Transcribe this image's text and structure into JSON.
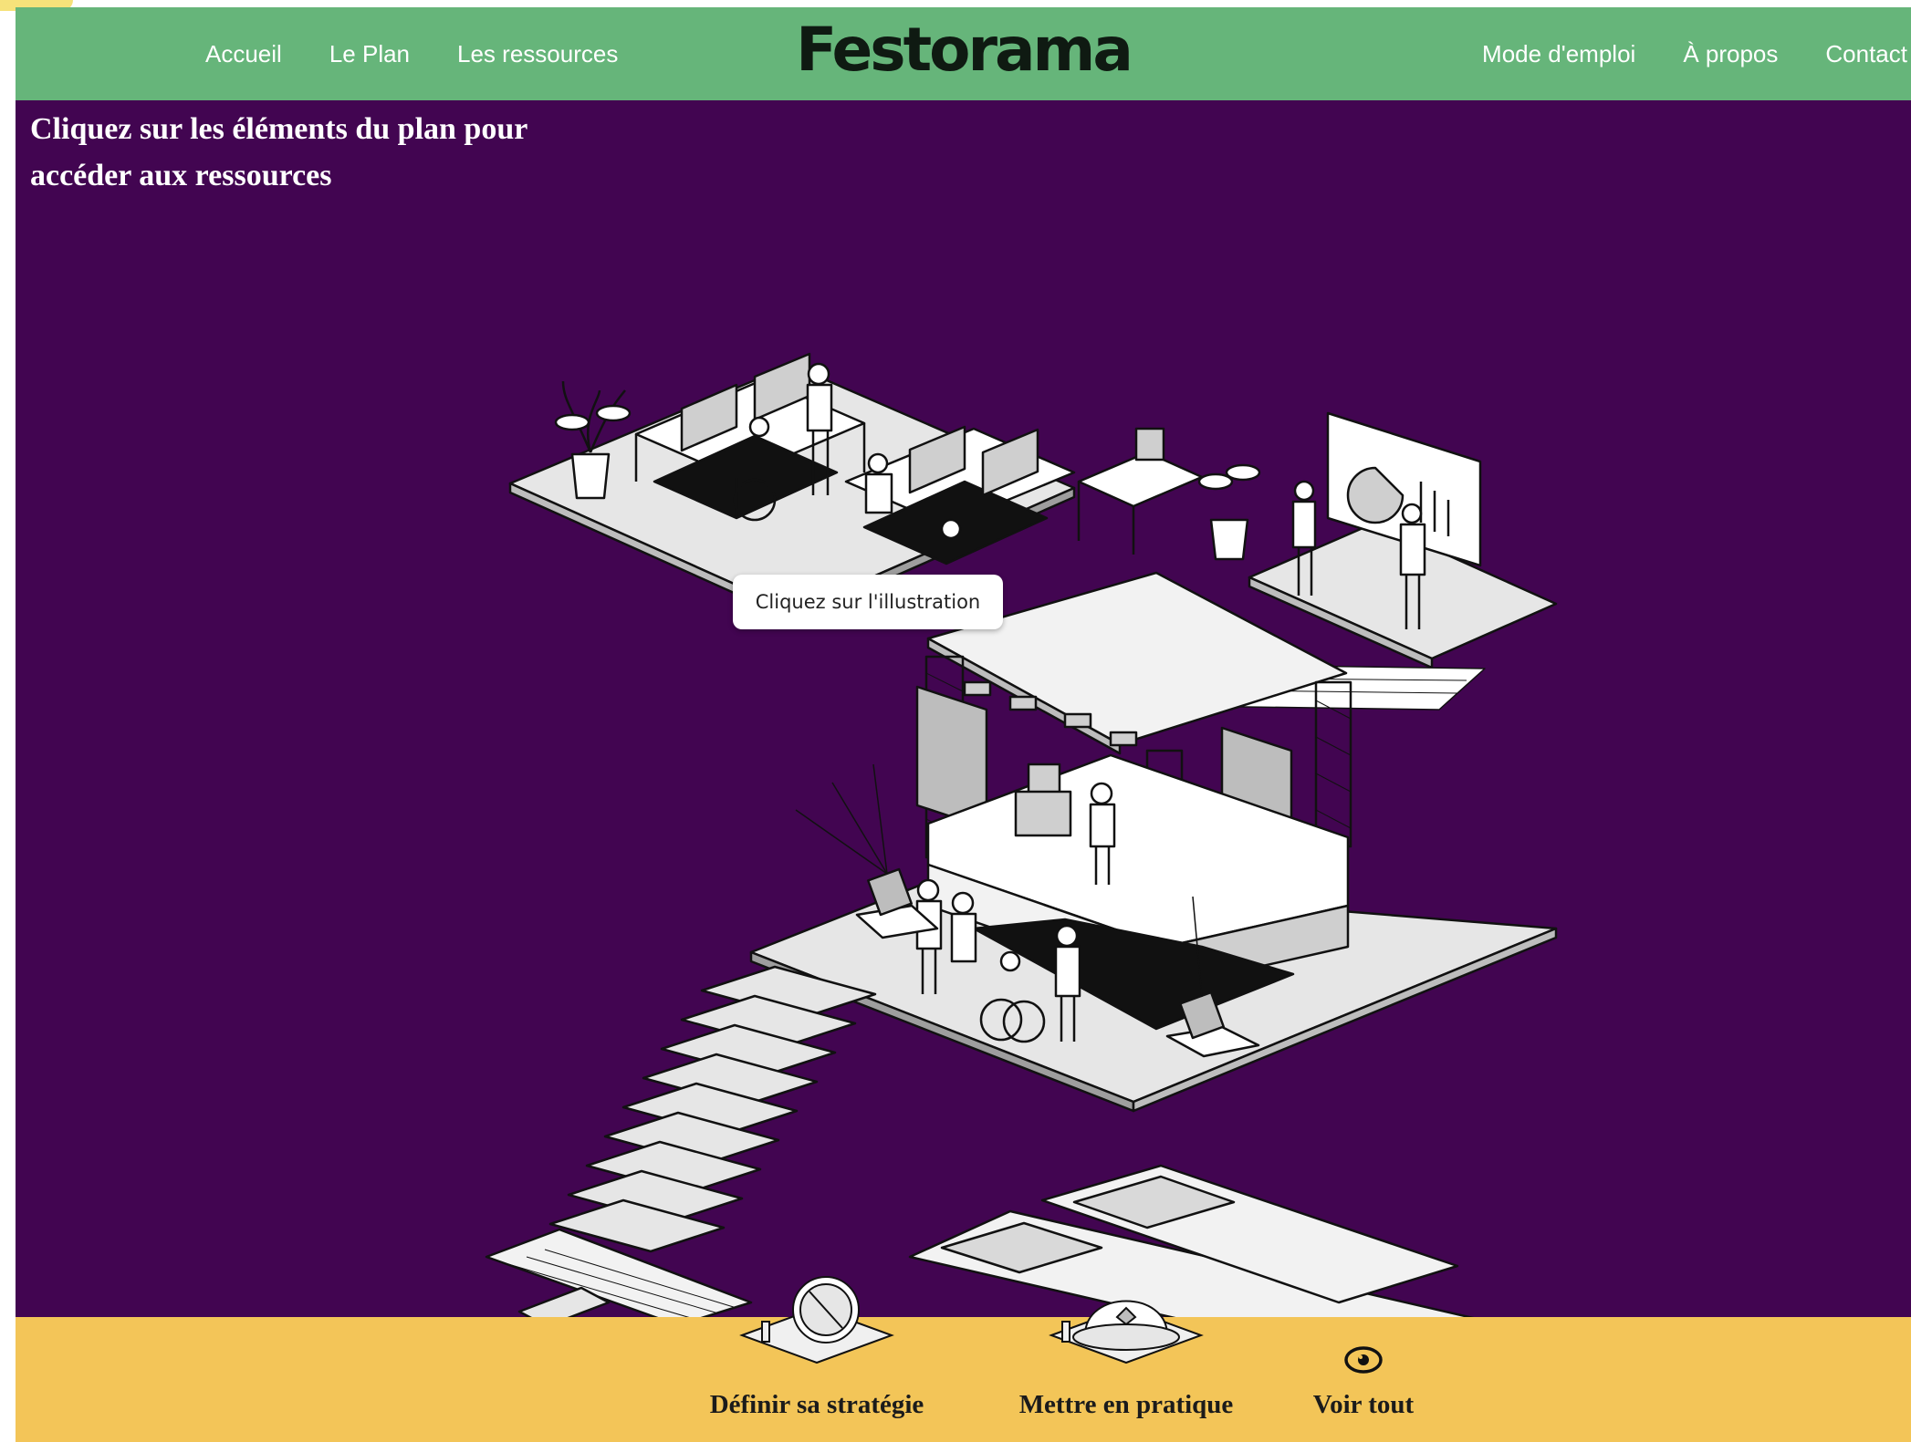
{
  "header": {
    "logo": "Festorama",
    "nav_left": [
      "Accueil",
      "Le Plan",
      "Les ressources"
    ],
    "nav_right": [
      "Mode d'emploi",
      "À propos",
      "Contact"
    ],
    "background": "#66b57a"
  },
  "main": {
    "headline_line1": "Cliquez sur les éléments du plan pour",
    "headline_line2": "accéder aux ressources",
    "tooltip": "Cliquez sur l'illustration",
    "background": "#420551"
  },
  "footer": {
    "background": "#f3c558",
    "items": [
      {
        "label": "Définir sa stratégie",
        "icon": "compass-icon"
      },
      {
        "label": "Mettre en pratique",
        "icon": "helmet-icon"
      },
      {
        "label": "Voir tout",
        "icon": "eye-icon"
      }
    ]
  }
}
